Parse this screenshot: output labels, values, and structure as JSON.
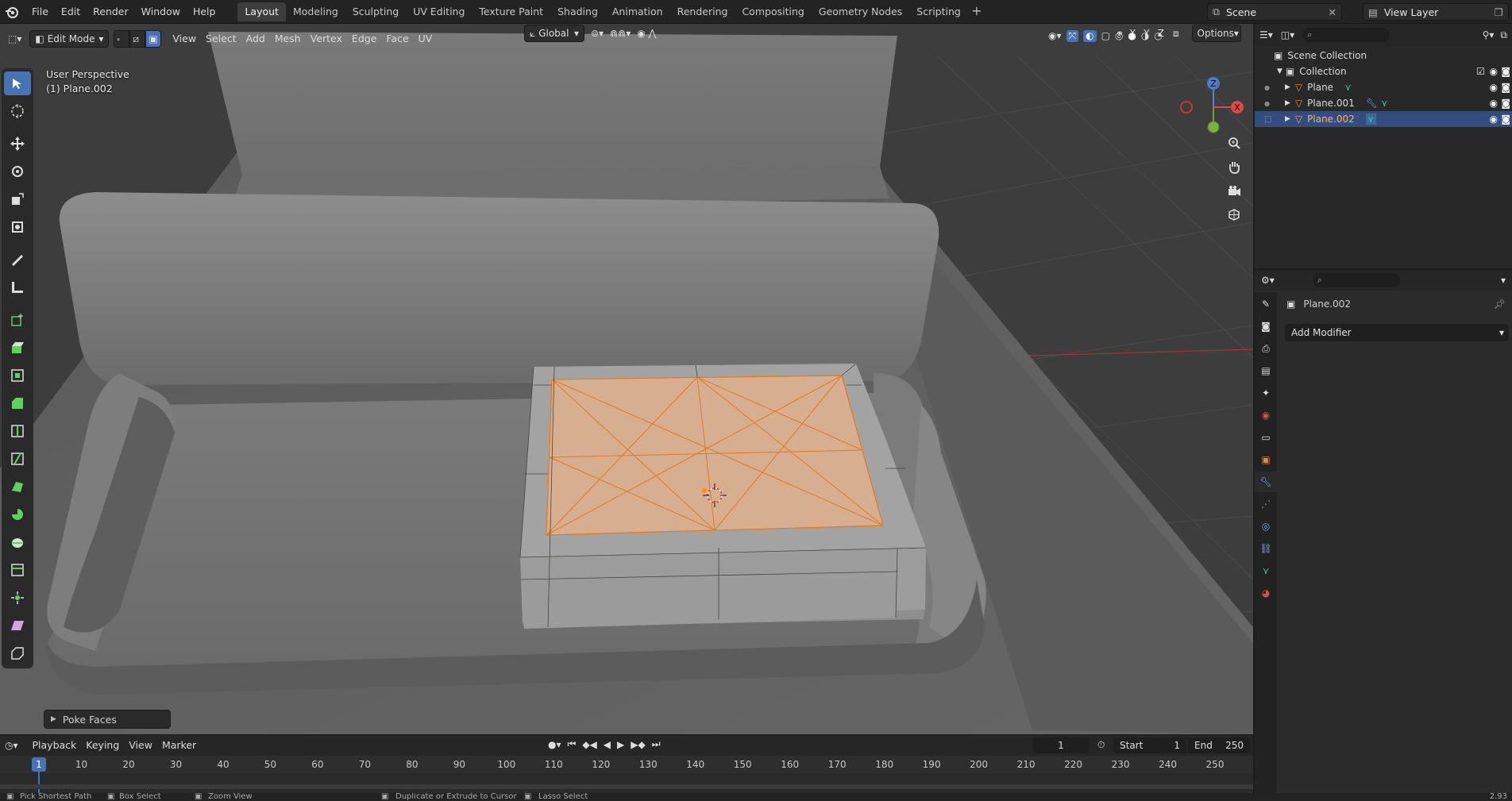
{
  "menus": [
    "File",
    "Edit",
    "Render",
    "Window",
    "Help"
  ],
  "workspaces": [
    "Layout",
    "Modeling",
    "Sculpting",
    "UV Editing",
    "Texture Paint",
    "Shading",
    "Animation",
    "Rendering",
    "Compositing",
    "Geometry Nodes",
    "Scripting"
  ],
  "active_workspace": "Layout",
  "scene": "Scene",
  "view_layer": "View Layer",
  "viewport": {
    "mode": "Edit Mode",
    "menus": [
      "View",
      "Select",
      "Add",
      "Mesh",
      "Vertex",
      "Edge",
      "Face",
      "UV"
    ],
    "orientation": "Global",
    "options_label": "Options",
    "perspective_label": "User Perspective",
    "object_label": "(1) Plane.002",
    "axis_x": "X",
    "axis_y": "Y",
    "axis_z": "Z",
    "gizmo_x": "X",
    "gizmo_y": "Y",
    "gizmo_z": "Z"
  },
  "operator_panel": "Poke Faces",
  "outliner": {
    "scene_collection": "Scene Collection",
    "collection": "Collection",
    "objects": [
      "Plane",
      "Plane.001",
      "Plane.002"
    ]
  },
  "properties": {
    "object_name": "Plane.002",
    "add_modifier": "Add Modifier"
  },
  "timeline": {
    "menus": [
      "Playback",
      "Keying",
      "View",
      "Marker"
    ],
    "current_frame": "1",
    "start_label": "Start",
    "start_value": "1",
    "end_label": "End",
    "end_value": "250",
    "ticks": [
      "1",
      "10",
      "20",
      "30",
      "40",
      "50",
      "60",
      "70",
      "80",
      "90",
      "100",
      "110",
      "120",
      "130",
      "140",
      "150",
      "160",
      "170",
      "180",
      "190",
      "200",
      "210",
      "220",
      "230",
      "240",
      "250"
    ]
  },
  "status_bar": {
    "items": [
      "Pick Shortest Path",
      "Box Select",
      "Zoom View",
      "Duplicate or Extrude to Cursor",
      "Lasso Select"
    ],
    "version": "2.93"
  },
  "colors": {
    "accent": "#4772b3",
    "selection": "#e07a1f",
    "face_select": "#d7a98a",
    "outliner_selected": "#334d80"
  }
}
